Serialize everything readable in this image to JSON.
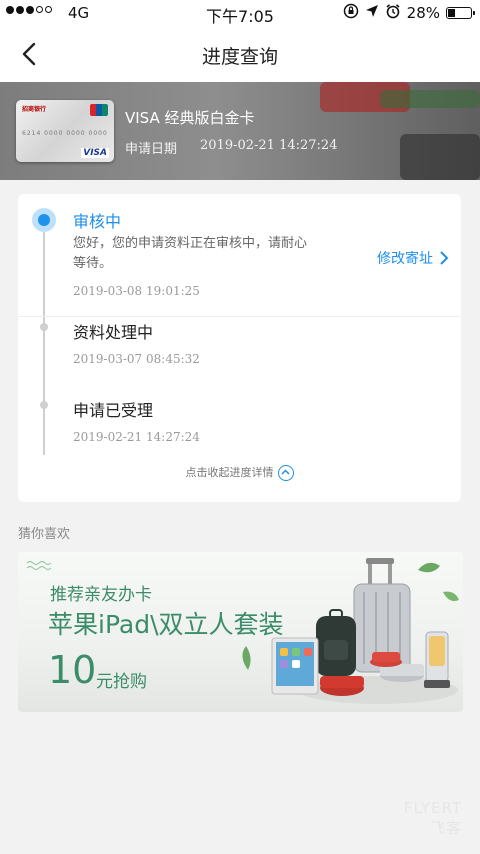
{
  "status": {
    "network": "4G",
    "time": "下午7:05",
    "battery": "28%",
    "battery_level": 0.28,
    "signal_bars_filled": 3,
    "signal_bars_total": 5
  },
  "nav": {
    "title": "进度查询"
  },
  "card": {
    "bank_name": "招商银行",
    "brand": "VISA",
    "number_masked": "6214 0000 0000 0000",
    "name": "VISA 经典版白金卡",
    "apply_label": "申请日期",
    "apply_date": "2019-02-21 14:27:24"
  },
  "progress": {
    "steps": [
      {
        "title": "审核中",
        "desc": "您好，您的申请资料正在审核中，请耐心等待。",
        "time": "2019-03-08 19:01:25",
        "active": true
      },
      {
        "title": "资料处理中",
        "time": "2019-03-07 08:45:32"
      },
      {
        "title": "申请已受理",
        "time": "2019-02-21 14:27:24"
      }
    ],
    "modify_link": "修改寄址",
    "collapse_label": "点击收起进度详情"
  },
  "recommend": {
    "section_title": "猜你喜欢",
    "ad": {
      "line1": "推荐亲友办卡",
      "line2": "苹果iPad\\双立人套装",
      "price": "10",
      "unit": "元抢购"
    }
  },
  "watermark": {
    "en": "FLYERT",
    "zh": "飞客"
  },
  "colors": {
    "accent": "#1f8fe8",
    "ad_green": "#3b8c68"
  }
}
